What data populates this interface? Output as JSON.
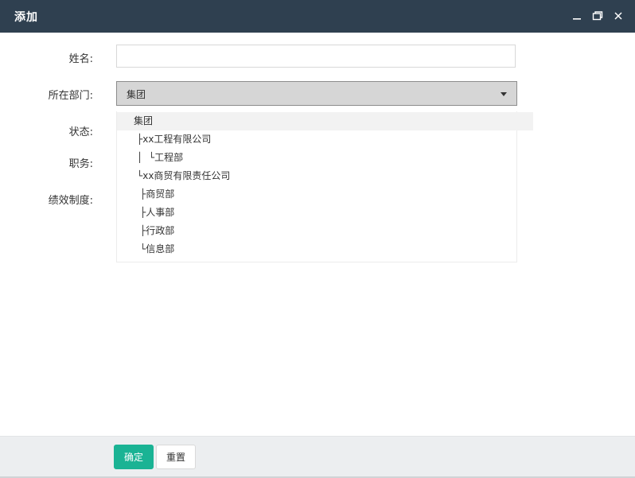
{
  "window": {
    "title": "添加",
    "controls": {
      "minimize_icon": "minimize-icon",
      "maximize_icon": "maximize-icon",
      "close_icon": "close-icon"
    }
  },
  "form": {
    "name_label": "姓名:",
    "name_value": "",
    "department_label": "所在部门:",
    "department_value": "集团",
    "status_label": "状态:",
    "position_label": "职务:",
    "performance_label": "绩效制度:"
  },
  "dropdown": {
    "options": [
      "集团",
      "├xx工程有限公司",
      "│  └工程部",
      "└xx商贸有限责任公司",
      "├商贸部",
      "├人事部",
      "├行政部",
      "└信息部"
    ]
  },
  "footer": {
    "confirm_label": "确定",
    "reset_label": "重置"
  },
  "colors": {
    "titlebar": "#2f4050",
    "confirm_button": "#1ab394",
    "footer_bg": "#eceef0",
    "select_bg": "#d6d6d6"
  }
}
